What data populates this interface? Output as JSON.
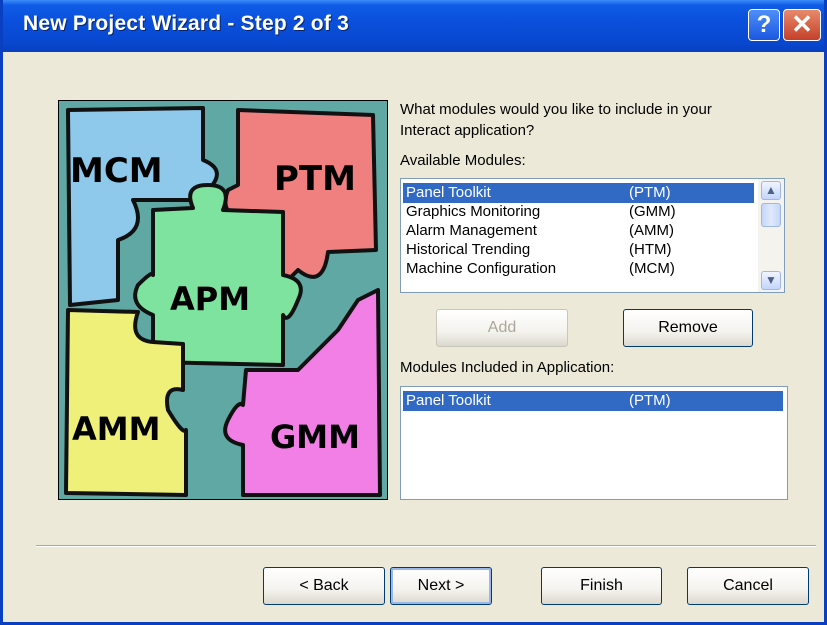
{
  "window": {
    "title": "New Project Wizard - Step 2 of 3",
    "help_label": "?",
    "close_label": "✕"
  },
  "graphic": {
    "pieces": [
      "MCM",
      "PTM",
      "APM",
      "AMM",
      "GMM"
    ]
  },
  "prompt": "What modules would you like to include in your Interact application?",
  "prompt_line1": "What modules would you like to include in your",
  "prompt_line2": "Interact application?",
  "available": {
    "label": "Available Modules:",
    "items": [
      {
        "name": "Panel Toolkit",
        "code": "(PTM)"
      },
      {
        "name": "Graphics Monitoring",
        "code": "(GMM)"
      },
      {
        "name": "Alarm Management",
        "code": "(AMM)"
      },
      {
        "name": "Historical Trending",
        "code": "(HTM)"
      },
      {
        "name": "Machine Configuration",
        "code": "(MCM)"
      }
    ]
  },
  "buttons": {
    "add": "Add",
    "remove": "Remove",
    "back": "< Back",
    "next": "Next >",
    "finish": "Finish",
    "cancel": "Cancel"
  },
  "included": {
    "label": "Modules Included in Application:",
    "items": [
      {
        "name": "Panel Toolkit",
        "code": "(PTM)"
      }
    ]
  },
  "colors": {
    "titlebar": "#0a50dc",
    "selection": "#316ac5",
    "mcm": "#8ec9ec",
    "ptm": "#f07f80",
    "apm": "#7fe3a0",
    "amm": "#eef07a",
    "gmm": "#f27fe6",
    "background": "#5fa8a4"
  }
}
